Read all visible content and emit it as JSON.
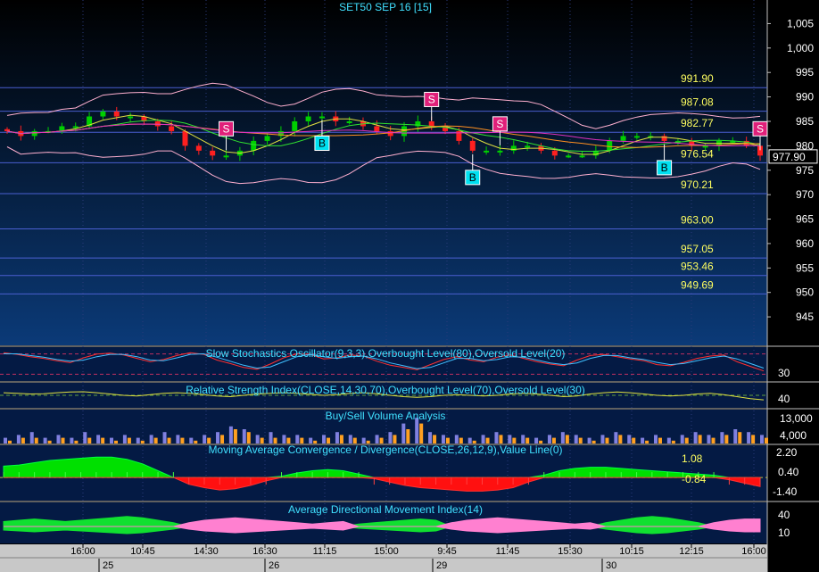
{
  "title": "SET50 SEP 16  [15]",
  "colors": {
    "background_top": "#000000",
    "background_bottom": "#0b3a78",
    "grid": "#2a3a7a",
    "hline": "#4a5fd0",
    "candle_up": "#00d000",
    "candle_down": "#ff2020",
    "bollinger": "#ffb0d0",
    "ma_yellow": "#e0e040",
    "ma_green": "#30e030",
    "ma_orange": "#ff9020",
    "ma_magenta": "#e030c0",
    "sell_marker": "#e0207a",
    "buy_marker": "#00e0f0",
    "panel_label": "#40e0ff",
    "level_label": "#ffff60",
    "axis_text": "#ffffff",
    "last_price_box": "#000000"
  },
  "price_axis": {
    "ticks": [
      "1,005",
      "1,000",
      "995",
      "990",
      "985",
      "980",
      "975",
      "970",
      "965",
      "960",
      "955",
      "950",
      "945"
    ],
    "last_price": "977.90"
  },
  "chart_data": [
    {
      "type": "candlestick",
      "title": "SET50 SEP 16  [15]",
      "y_range": [
        941,
        1008
      ],
      "close_points": [
        983,
        982,
        983,
        983,
        984,
        984,
        986,
        987,
        986,
        986,
        985,
        984,
        983,
        980,
        979,
        978,
        978,
        979,
        981,
        982,
        983,
        985,
        986,
        986,
        985,
        985,
        984,
        983,
        982,
        984,
        985,
        984,
        983,
        981,
        979,
        979,
        979,
        980,
        980,
        979,
        978,
        978,
        978,
        979,
        981,
        982,
        982,
        982,
        981,
        981,
        980,
        980,
        981,
        981,
        980,
        978
      ],
      "horizontal_levels": [
        {
          "value": 991.9,
          "label": "991.90"
        },
        {
          "value": 987.08,
          "label": "987.08"
        },
        {
          "value": 982.77,
          "label": "982.77"
        },
        {
          "value": 976.54,
          "label": "976.54"
        },
        {
          "value": 970.21,
          "label": "970.21"
        },
        {
          "value": 963.0,
          "label": "963.00"
        },
        {
          "value": 957.05,
          "label": "957.05"
        },
        {
          "value": 953.46,
          "label": "953.46"
        },
        {
          "value": 949.69,
          "label": "949.69"
        }
      ],
      "signals": [
        {
          "type": "S",
          "at": 16
        },
        {
          "type": "S",
          "at": 31
        },
        {
          "type": "S",
          "at": 36
        },
        {
          "type": "S",
          "at": 55
        },
        {
          "type": "B",
          "at": 23
        },
        {
          "type": "B",
          "at": 34
        },
        {
          "type": "B",
          "at": 48
        }
      ]
    },
    {
      "type": "line",
      "title": "Slow Stochastics Oscillator(9,3,3),Overbought Level(80),Oversold Level(20)",
      "y_ticks": [
        "30"
      ],
      "series": [
        {
          "values": [
            90,
            84,
            76,
            70,
            62,
            55,
            72,
            85,
            88,
            82,
            70,
            58,
            66,
            80,
            90,
            84,
            64,
            52,
            38,
            32,
            50,
            72,
            86,
            84,
            68,
            72,
            82,
            78,
            60,
            46,
            38,
            30,
            48,
            66,
            76,
            64,
            58,
            74,
            82,
            70,
            58,
            50,
            44,
            64,
            80,
            84,
            76,
            68,
            62,
            48,
            44,
            56,
            70,
            78,
            82,
            58,
            42,
            26
          ]
        },
        {
          "values": [
            86,
            86,
            80,
            74,
            66,
            60,
            64,
            76,
            84,
            84,
            76,
            64,
            62,
            72,
            84,
            86,
            74,
            60,
            46,
            36,
            40,
            58,
            76,
            84,
            76,
            70,
            76,
            78,
            68,
            54,
            44,
            34,
            38,
            54,
            70,
            70,
            62,
            66,
            76,
            74,
            64,
            54,
            48,
            54,
            70,
            80,
            80,
            72,
            66,
            56,
            48,
            52,
            62,
            72,
            78,
            68,
            52,
            36
          ]
        }
      ]
    },
    {
      "type": "line",
      "title": "Relative Strength Index(CLOSE,14,30,70),Overbought Level(70),Oversold Level(30)",
      "y_ticks": [
        "40"
      ],
      "series": [
        {
          "values": [
            58,
            56,
            54,
            55,
            58,
            60,
            61,
            58,
            54,
            50,
            48,
            52,
            56,
            58,
            56,
            52,
            48,
            46,
            50,
            54,
            56,
            58,
            56,
            53,
            50,
            52,
            56,
            58,
            55,
            50,
            46,
            44,
            46,
            50,
            52,
            50,
            48,
            50,
            54,
            56,
            54,
            50,
            46,
            48,
            54,
            58,
            60,
            58,
            54,
            50,
            48,
            50,
            54,
            56,
            52,
            46,
            40,
            36
          ]
        }
      ]
    },
    {
      "type": "bar",
      "title": "Buy/Sell Volume Analysis",
      "y_ticks": [
        "13,000",
        "4,000"
      ],
      "series": [
        {
          "name": "buy",
          "values": [
            2,
            3,
            4,
            2,
            3,
            2,
            4,
            3,
            2,
            3,
            2,
            3,
            4,
            3,
            2,
            3,
            4,
            6,
            5,
            3,
            4,
            3,
            3,
            2,
            3,
            4,
            3,
            2,
            3,
            4,
            7,
            9,
            4,
            3,
            3,
            2,
            3,
            4,
            3,
            3,
            2,
            3,
            4,
            3,
            2,
            3,
            4,
            3,
            2,
            3,
            2,
            3,
            4,
            3,
            4,
            5,
            4,
            3
          ]
        },
        {
          "name": "sell",
          "values": [
            1,
            2,
            2,
            1,
            2,
            1,
            2,
            2,
            1,
            2,
            1,
            2,
            2,
            2,
            1,
            2,
            3,
            5,
            4,
            2,
            2,
            2,
            2,
            1,
            2,
            3,
            2,
            1,
            2,
            3,
            5,
            7,
            3,
            2,
            2,
            1,
            2,
            3,
            2,
            2,
            1,
            2,
            3,
            2,
            1,
            2,
            3,
            2,
            1,
            2,
            1,
            2,
            3,
            2,
            3,
            4,
            3,
            2
          ]
        }
      ]
    },
    {
      "type": "area",
      "title": "Moving Average Convergence / Divergence(CLOSE,26,12,9),Value Line(0)",
      "y_ticks": [
        "2.20",
        "0.40",
        "-1.40"
      ],
      "annotations": [
        "1.08",
        "-0.84"
      ],
      "series": [
        {
          "values": [
            1.0,
            1.1,
            1.3,
            1.5,
            1.6,
            1.7,
            1.8,
            1.8,
            1.6,
            1.2,
            0.6,
            0.0,
            -0.6,
            -0.9,
            -1.1,
            -1.0,
            -0.7,
            -0.3,
            0.1,
            0.4,
            0.6,
            0.7,
            0.6,
            0.3,
            -0.1,
            -0.4,
            -0.7,
            -0.9,
            -1.0,
            -1.1,
            -1.2,
            -1.2,
            -1.1,
            -0.9,
            -0.4,
            0.2,
            0.6,
            0.8,
            0.9,
            0.9,
            0.8,
            0.7,
            0.6,
            0.5,
            0.4,
            0.3,
            0.2,
            -0.2,
            -0.5,
            -0.8
          ]
        }
      ]
    },
    {
      "type": "area",
      "title": "Average Directional Movement Index(14)",
      "y_ticks": [
        "40",
        "10"
      ],
      "series": [
        {
          "name": "green",
          "values": [
            8,
            10,
            12,
            10,
            8,
            10,
            12,
            14,
            16,
            14,
            10,
            6,
            0,
            0,
            0,
            0,
            0,
            0,
            0,
            0,
            0,
            0,
            0,
            4,
            6,
            8,
            10,
            12,
            10,
            0,
            0,
            0,
            0,
            0,
            0,
            0,
            0,
            0,
            0,
            6,
            10,
            14,
            16,
            14,
            10,
            6,
            0,
            0,
            0,
            0
          ]
        },
        {
          "name": "pink",
          "values": [
            0,
            0,
            0,
            0,
            0,
            0,
            0,
            0,
            0,
            0,
            0,
            0,
            6,
            10,
            12,
            14,
            12,
            10,
            8,
            6,
            4,
            6,
            8,
            0,
            0,
            0,
            0,
            0,
            0,
            6,
            10,
            12,
            14,
            12,
            10,
            8,
            6,
            4,
            6,
            0,
            0,
            0,
            0,
            0,
            0,
            0,
            6,
            10,
            12,
            12
          ]
        }
      ]
    }
  ],
  "x_axis": {
    "time_ticks": [
      "16:00",
      "10:45",
      "14:30",
      "16:30",
      "11:15",
      "15:00",
      "9:45",
      "11:45",
      "15:30",
      "10:15",
      "12:15",
      "16:00"
    ],
    "date_ticks": [
      "25",
      "26",
      "29",
      "30"
    ]
  }
}
